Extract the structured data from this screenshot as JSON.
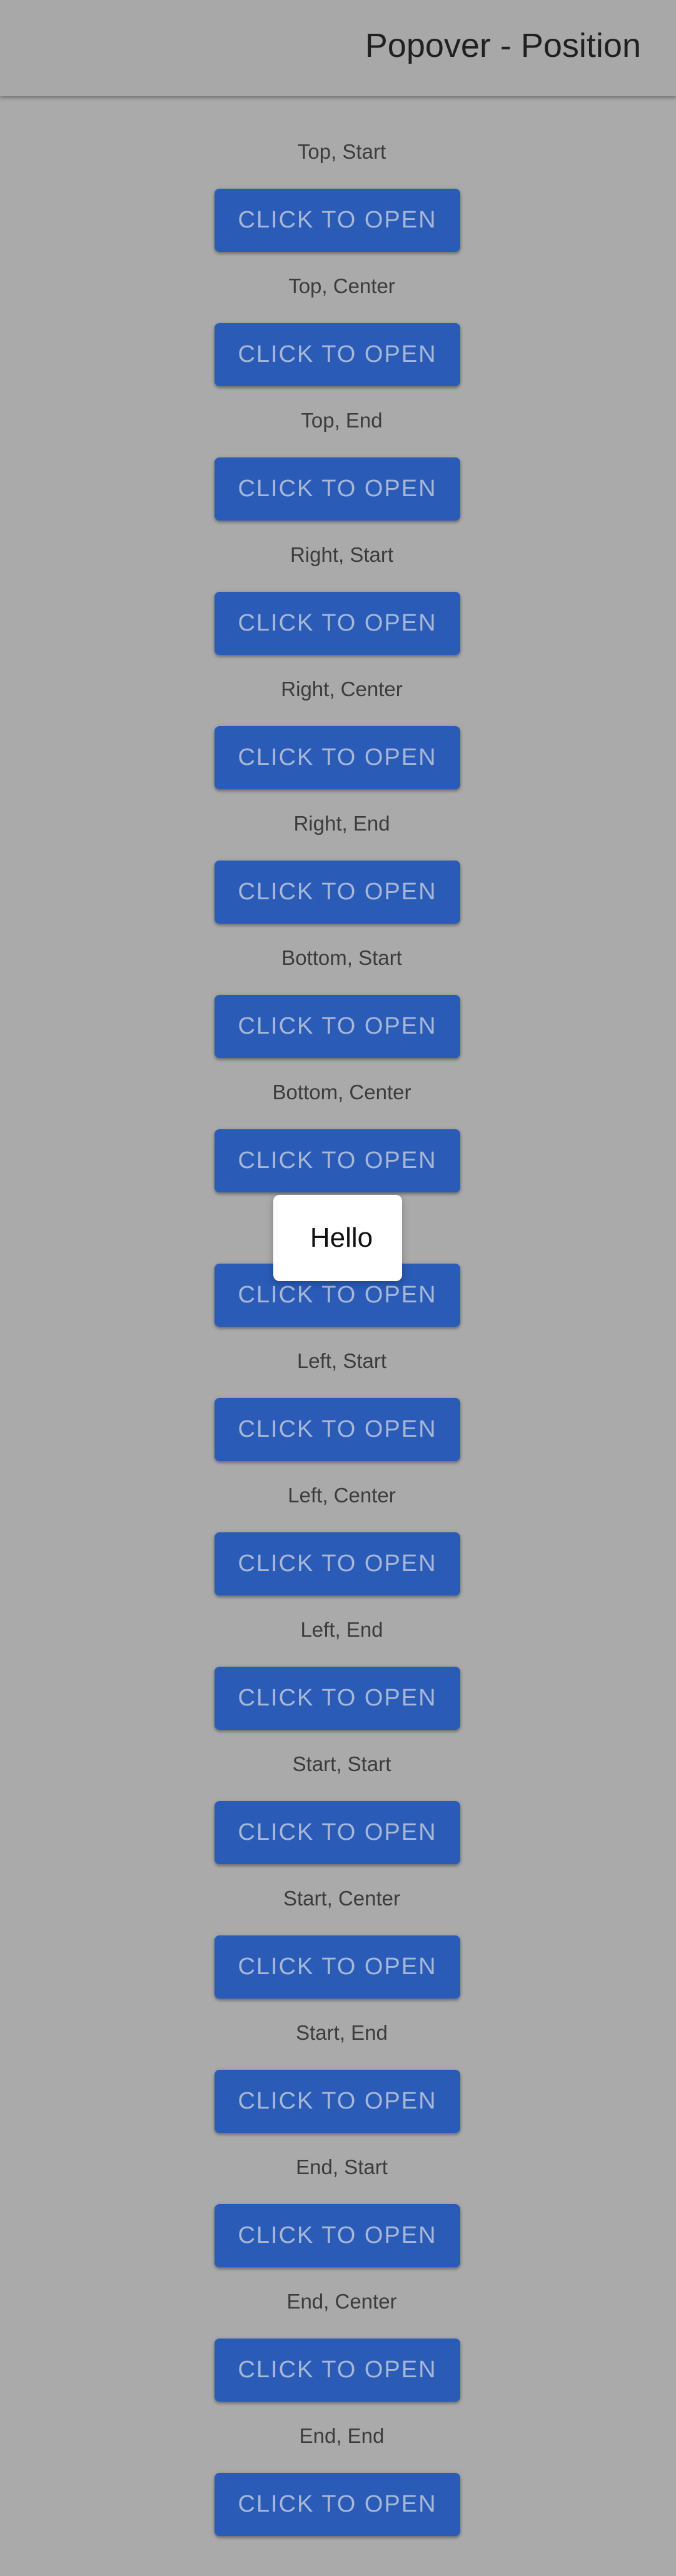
{
  "toolbar": {
    "title": "Popover - Position"
  },
  "sections": [
    {
      "label": "Top, Start",
      "button": "CLICK TO OPEN"
    },
    {
      "label": "Top, Center",
      "button": "CLICK TO OPEN"
    },
    {
      "label": "Top, End",
      "button": "CLICK TO OPEN"
    },
    {
      "label": "Right, Start",
      "button": "CLICK TO OPEN"
    },
    {
      "label": "Right, Center",
      "button": "CLICK TO OPEN"
    },
    {
      "label": "Right, End",
      "button": "CLICK TO OPEN"
    },
    {
      "label": "Bottom, Start",
      "button": "CLICK TO OPEN"
    },
    {
      "label": "Bottom, Center",
      "button": "CLICK TO OPEN"
    },
    {
      "label": "",
      "button": "CLICK TO OPEN"
    },
    {
      "label": "Left, Start",
      "button": "CLICK TO OPEN"
    },
    {
      "label": "Left, Center",
      "button": "CLICK TO OPEN"
    },
    {
      "label": "Left, End",
      "button": "CLICK TO OPEN"
    },
    {
      "label": "Start, Start",
      "button": "CLICK TO OPEN"
    },
    {
      "label": "Start, Center",
      "button": "CLICK TO OPEN"
    },
    {
      "label": "Start, End",
      "button": "CLICK TO OPEN"
    },
    {
      "label": "End, Start",
      "button": "CLICK TO OPEN"
    },
    {
      "label": "End, Center",
      "button": "CLICK TO OPEN"
    },
    {
      "label": "End, End",
      "button": "CLICK TO OPEN"
    }
  ],
  "popover": {
    "text": "Hello"
  },
  "colors": {
    "backdrop": "#aaaaaa",
    "button": "#2a5bb6",
    "button_text": "#a7b7d8",
    "popover_bg": "#ffffff"
  }
}
